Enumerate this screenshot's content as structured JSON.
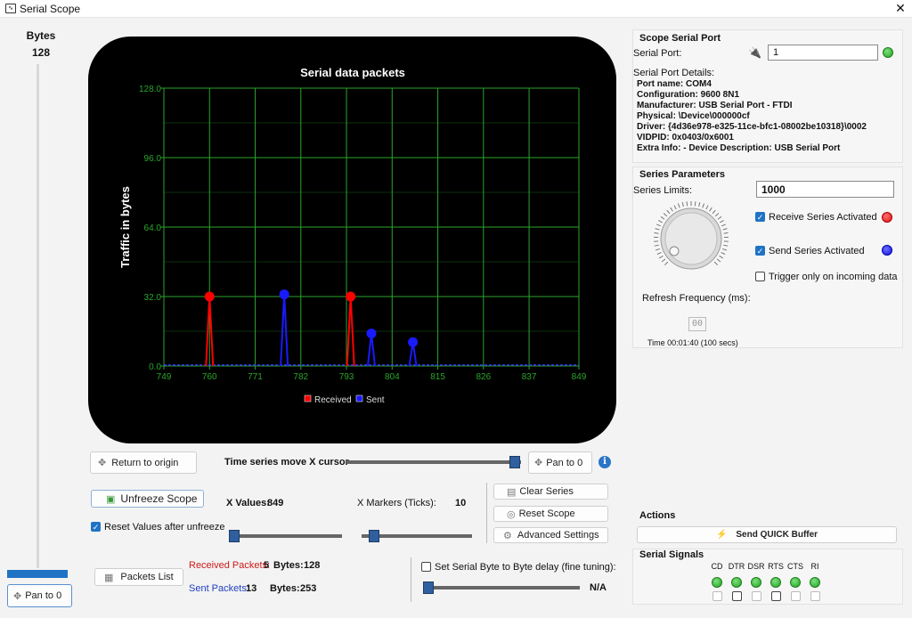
{
  "window": {
    "title": "Serial Scope",
    "close_glyph": "✕",
    "icon": "scope-app-icon"
  },
  "left_slider": {
    "label": "Bytes",
    "value": "128"
  },
  "chart_data": {
    "type": "line",
    "title": "Serial data packets",
    "xlabel": "",
    "ylabel": "Traffic in bytes",
    "x_ticks": [
      "749",
      "760",
      "771",
      "782",
      "793",
      "804",
      "815",
      "826",
      "837",
      "849"
    ],
    "y_ticks": [
      "0.0",
      "32.0",
      "64.0",
      "96.0",
      "128.0"
    ],
    "xlim": [
      749,
      849
    ],
    "ylim": [
      0,
      128
    ],
    "grid": true,
    "legend_position": "bottom-center",
    "series": [
      {
        "name": "Received",
        "color": "#ff0000",
        "spikes": [
          {
            "x": 760,
            "y": 32
          },
          {
            "x": 794,
            "y": 32
          }
        ]
      },
      {
        "name": "Sent",
        "color": "#1a1aff",
        "spikes": [
          {
            "x": 778,
            "y": 33
          },
          {
            "x": 799,
            "y": 15
          },
          {
            "x": 809,
            "y": 11
          }
        ]
      }
    ]
  },
  "controls": {
    "return_origin": "Return to origin",
    "time_series_label": "Time series move X cursor",
    "time_series_value": 1.0,
    "pan_to_0": "Pan to 0",
    "unfreeze": "Unfreeze Scope",
    "reset_values": "Reset Values after unfreeze",
    "x_values_label": "X Values:",
    "x_values_value": "849",
    "x_values_slider": 0.0,
    "x_markers_label": "X Markers (Ticks):",
    "x_markers_value": "10",
    "x_markers_slider": 0.1,
    "clear_series": "Clear Series",
    "reset_scope": "Reset Scope",
    "advanced_settings": "Advanced Settings",
    "packets_list": "Packets List",
    "received_packets_label": "Received Packets:",
    "received_packets_value": "5",
    "received_bytes_label": "Bytes:",
    "received_bytes_value": "128",
    "sent_packets_label": "Sent Packets:",
    "sent_packets_value": "13",
    "sent_bytes_label": "Bytes:",
    "sent_bytes_value": "253",
    "byte_delay_label": "Set Serial Byte to Byte delay (fine tuning):",
    "byte_delay_value": "N/A",
    "byte_delay_slider": 0.0,
    "left_pan": "Pan to 0"
  },
  "scope_port": {
    "title": "Scope Serial Port",
    "serial_port_label": "Serial Port:",
    "serial_port_value": "1",
    "details_label": "Serial Port Details:",
    "details": [
      "Port name: COM4",
      "Configuration: 9600 8N1",
      "Manufacturer: USB Serial Port - FTDI",
      "Physical: \\Device\\000000cf",
      "Driver: {4d36e978-e325-11ce-bfc1-08002be10318}\\0002",
      "VIDPID: 0x0403/0x6001",
      "Extra Info:  - Device Description: USB Serial Port"
    ]
  },
  "series_params": {
    "title": "Series Parameters",
    "limits_label": "Series Limits:",
    "limits_value": "1000",
    "receive_activated": "Receive Series Activated",
    "send_activated": "Send Series Activated",
    "trigger_incoming": "Trigger only on incoming data",
    "refresh_label": "Refresh Frequency (ms):",
    "time_label": "Time 00:01:40 (100 secs)",
    "receive_color": "#e01010",
    "send_color": "#1010e0"
  },
  "actions": {
    "title": "Actions",
    "send_quick": "Send QUICK Buffer"
  },
  "signals": {
    "title": "Serial Signals",
    "names": [
      "CD",
      "DTR",
      "DSR",
      "RTS",
      "CTS",
      "RI"
    ]
  }
}
